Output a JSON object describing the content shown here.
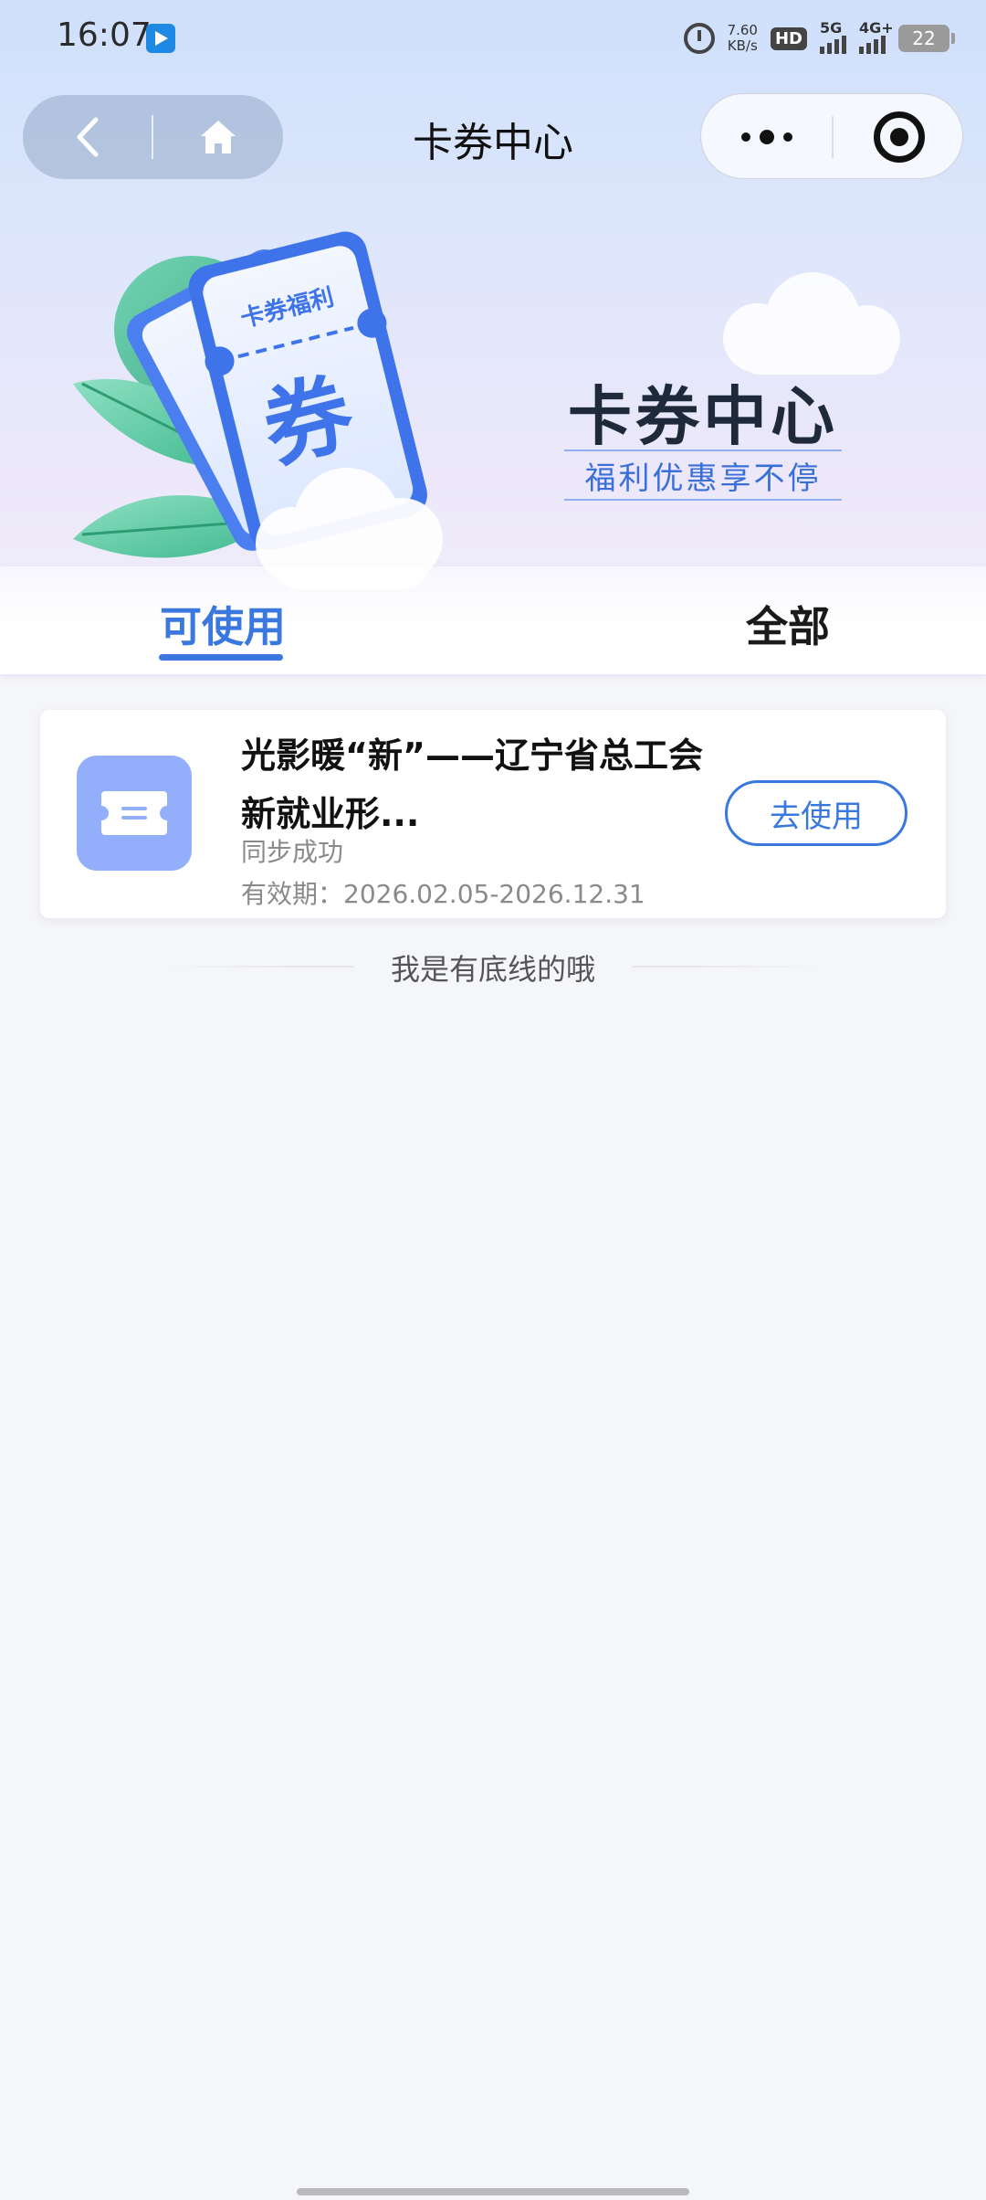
{
  "status_bar": {
    "time": "16:07",
    "net_speed_value": "7.60",
    "net_speed_unit": "KB/s",
    "hd_label": "HD",
    "signal_1_label": "5G",
    "signal_2_label": "4G+",
    "battery": "22"
  },
  "nav": {
    "title": "卡券中心",
    "back_icon": "chevron-left-icon",
    "home_icon": "home-icon",
    "more_icon": "more-dots-icon",
    "target_icon": "target-icon"
  },
  "hero": {
    "ticket_label": "卡券福利",
    "ticket_char": "券",
    "title": "卡券中心",
    "subtitle": "福利优惠享不停"
  },
  "tabs": [
    {
      "label": "可使用",
      "active": true
    },
    {
      "label": "全部",
      "active": false
    }
  ],
  "coupons": [
    {
      "title": "光影暖“新”——辽宁省总工会新就业形...",
      "status": "同步成功",
      "validity": "有效期：2026.02.05-2026.12.31",
      "action": "去使用",
      "icon": "ticket-icon"
    }
  ],
  "end_text": "我是有底线的哦",
  "colors": {
    "accent": "#3a78e0",
    "icon_bg": "#93aefb",
    "page_bg": "#f5f6fa"
  }
}
